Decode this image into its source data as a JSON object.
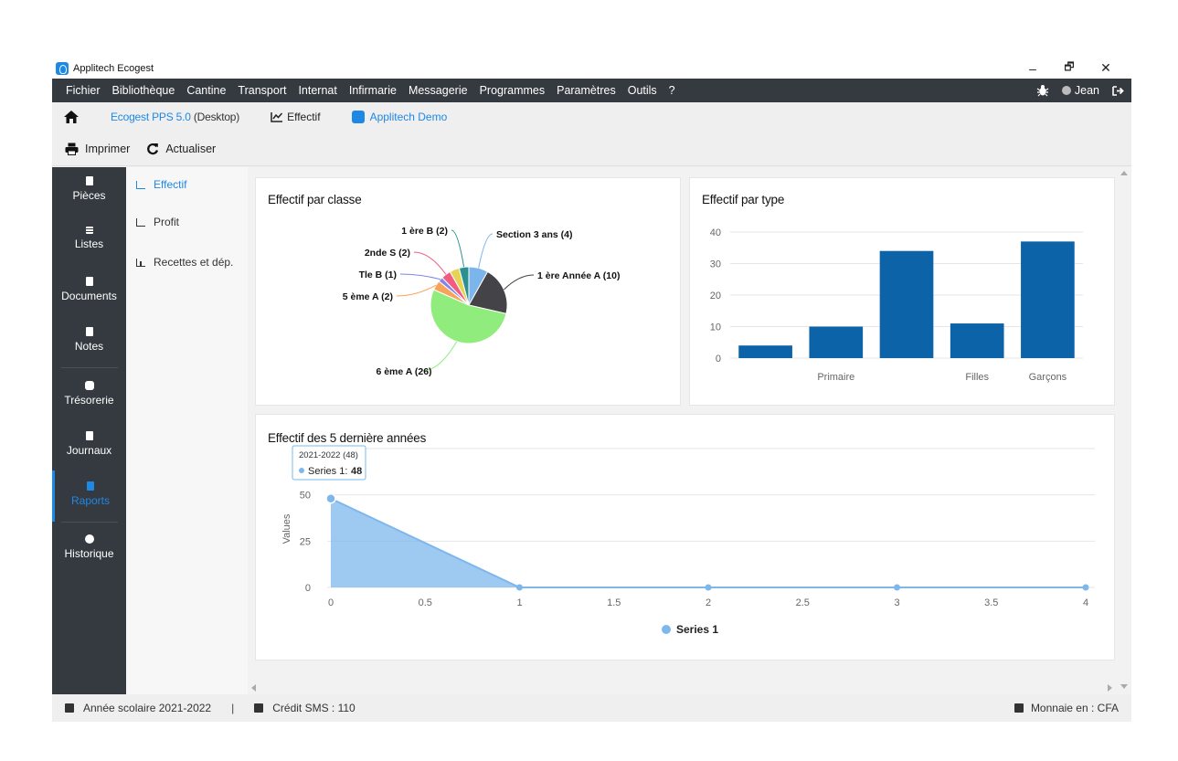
{
  "window": {
    "title": "Applitech Ecogest",
    "controls": [
      "–",
      "🗗",
      "✕"
    ]
  },
  "menu": {
    "items": [
      "Fichier",
      "Bibliothèque",
      "Cantine",
      "Transport",
      "Internat",
      "Infirmarie",
      "Messagerie",
      "Programmes",
      "Paramètres",
      "Outils",
      "?"
    ],
    "user": "Jean"
  },
  "toolbar": {
    "app_version": "Ecogest PPS 5.0",
    "app_mode": " (Desktop)",
    "effectif_label": "Effectif",
    "demo_label": "Applitech Demo",
    "print_label": "Imprimer",
    "refresh_label": "Actualiser"
  },
  "leftnav": {
    "items": [
      {
        "label": "Pièces",
        "icon": "file-icon"
      },
      {
        "label": "Listes",
        "icon": "list-icon"
      },
      {
        "label": "Documents",
        "icon": "document-icon"
      },
      {
        "label": "Notes",
        "icon": "notes-icon"
      },
      {
        "label": "Trésorerie",
        "icon": "treasury-icon"
      },
      {
        "label": "Journaux",
        "icon": "journal-icon"
      },
      {
        "label": "Raports",
        "icon": "report-icon"
      },
      {
        "label": "Historique",
        "icon": "history-icon"
      }
    ],
    "active": "Raports"
  },
  "subnav": {
    "items": [
      {
        "label": "Effectif",
        "active": true
      },
      {
        "label": "Profit",
        "active": false
      },
      {
        "label": "Recettes et dép.",
        "active": false
      }
    ]
  },
  "cards": {
    "pie_title": "Effectif par classe",
    "bar_title": "Effectif par type",
    "area_title": "Effectif des 5 dernière années"
  },
  "status": {
    "year": "Année scolaire 2021-2022",
    "sep": "|",
    "sms": "Crédit SMS : 110",
    "currency": "Monnaie en : CFA"
  },
  "colors": {
    "menu_bg": "#343a40",
    "accent": "#1e88e5",
    "bar": "#0d63a8",
    "area": "#7db7ec"
  },
  "chart_data": [
    {
      "type": "pie",
      "title": "Effectif par classe",
      "slices": [
        {
          "label": "Section 3 ans (4)",
          "value": 4,
          "color": "#7cb5ec"
        },
        {
          "label": "1 ère Année A (10)",
          "value": 10,
          "color": "#434348"
        },
        {
          "label": "6 ème A (26)",
          "value": 26,
          "color": "#90ed7d"
        },
        {
          "label": "5 ème A (2)",
          "value": 2,
          "color": "#f7a35c"
        },
        {
          "label": "Tle B (1)",
          "value": 1,
          "color": "#8085e9"
        },
        {
          "label": "2nde S (2)",
          "value": 2,
          "color": "#f15c80"
        },
        {
          "label": "",
          "value": 2,
          "color": "#e4d354"
        },
        {
          "label": "1 ère B (2)",
          "value": 2,
          "color": "#2b908f"
        }
      ]
    },
    {
      "type": "bar",
      "title": "Effectif par type",
      "categories": [
        "",
        "Primaire",
        "",
        "Filles",
        "Garçons"
      ],
      "values": [
        4,
        10,
        34,
        11,
        37
      ],
      "ylim": [
        0,
        40
      ],
      "yticks": [
        0,
        10,
        20,
        30,
        40
      ],
      "color": "#0d63a8"
    },
    {
      "type": "area",
      "title": "Effectif des 5 dernière années",
      "ylabel": "Values",
      "x": [
        0,
        1,
        2,
        3,
        4
      ],
      "series": [
        {
          "name": "Series 1",
          "values": [
            48,
            0,
            0,
            0,
            0
          ]
        }
      ],
      "xticks": [
        "0",
        "0.5",
        "1",
        "1.5",
        "2",
        "2.5",
        "3",
        "3.5",
        "4"
      ],
      "yticks": [
        0,
        25,
        50
      ],
      "ylim": [
        0,
        75
      ],
      "tooltip": {
        "header": "2021-2022 (48)",
        "series": "Series 1",
        "value": "48"
      }
    }
  ]
}
